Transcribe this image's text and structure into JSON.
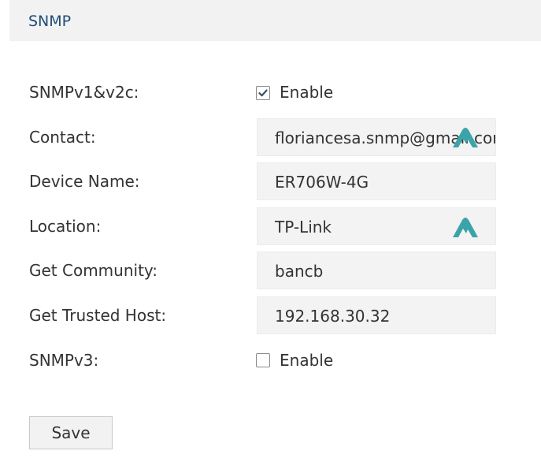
{
  "section": {
    "title": "SNMP"
  },
  "snmpv1v2c": {
    "label": "SNMPv1&v2c:",
    "checkbox_label": "Enable",
    "checked": true
  },
  "contact": {
    "label": "Contact:",
    "value": "floriancesa.snmp@gmail.com"
  },
  "device_name": {
    "label": "Device Name:",
    "value": "ER706W-4G"
  },
  "location": {
    "label": "Location:",
    "value": "TP-Link"
  },
  "get_community": {
    "label": "Get Community:",
    "value": "bancb"
  },
  "get_trusted_host": {
    "label": "Get Trusted Host:",
    "value": "192.168.30.32"
  },
  "snmpv3": {
    "label": "SNMPv3:",
    "checkbox_label": "Enable",
    "checked": false
  },
  "actions": {
    "save_label": "Save"
  },
  "overlay_icon": {
    "name": "nordpass-autofill-icon",
    "color": "#3aa4a9"
  },
  "colors": {
    "header_bg": "#f2f2f2",
    "title": "#1e4d78",
    "input_bg": "#f3f3f3"
  }
}
